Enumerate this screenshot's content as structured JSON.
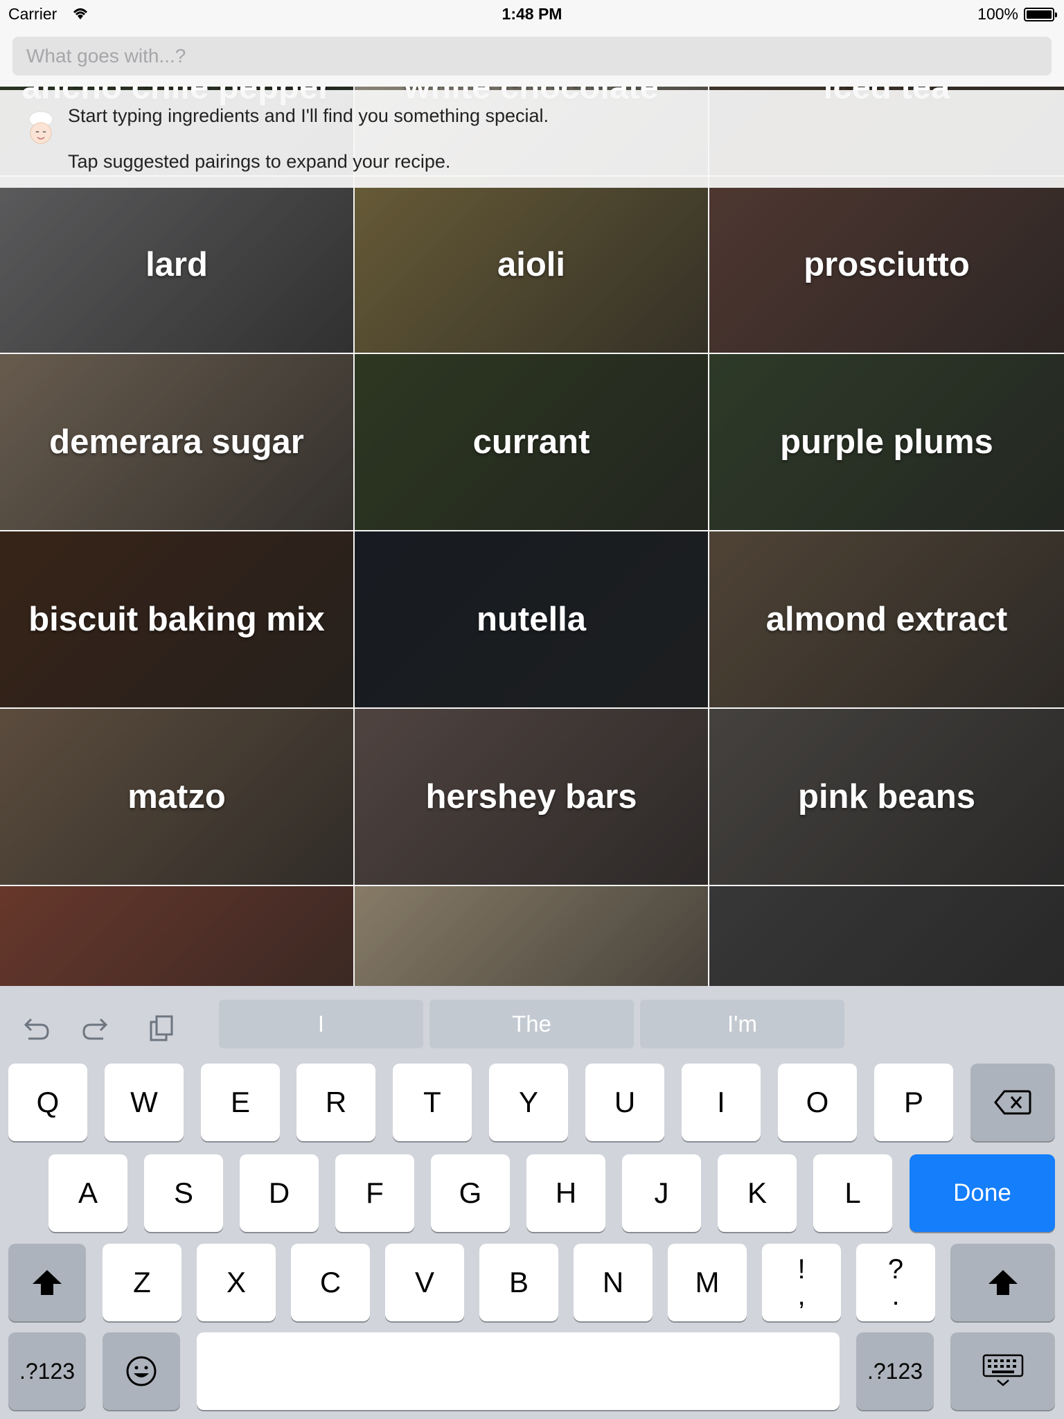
{
  "status": {
    "carrier": "Carrier",
    "time": "1:48 PM",
    "battery": "100%"
  },
  "search": {
    "placeholder": "What goes with...?"
  },
  "info": {
    "line1": "Start typing ingredients and I'll find you something special.",
    "line2": "Tap suggested pairings to expand your recipe."
  },
  "tiles": [
    {
      "label": "ancho chile pepper",
      "color": "#3a4a30"
    },
    {
      "label": "white chocolate",
      "color": "#c9c0ad"
    },
    {
      "label": "iced tea",
      "color": "#5a4a3a"
    },
    {
      "label": "lard",
      "color": "#7a7a7c"
    },
    {
      "label": "aioli",
      "color": "#8a7a4a"
    },
    {
      "label": "prosciutto",
      "color": "#6a4a42"
    },
    {
      "label": "demerara sugar",
      "color": "#8a7a68"
    },
    {
      "label": "currant",
      "color": "#3c4a2c"
    },
    {
      "label": "purple plums",
      "color": "#3e4e36"
    },
    {
      "label": "biscuit baking mix",
      "color": "#4a3020"
    },
    {
      "label": "nutella",
      "color": "#1f252c"
    },
    {
      "label": "almond extract",
      "color": "#6a5a48"
    },
    {
      "label": "matzo",
      "color": "#7a6652"
    },
    {
      "label": "hershey bars",
      "color": "#6a5a55"
    },
    {
      "label": "pink beans",
      "color": "#5c5854"
    },
    {
      "label": "",
      "color": "#8a4a3a"
    },
    {
      "label": "",
      "color": "#b5a58a"
    },
    {
      "label": "",
      "color": "#4a4a4a"
    }
  ],
  "keyboard": {
    "suggestions": [
      "I",
      "The",
      "I'm"
    ],
    "row1": [
      "Q",
      "W",
      "E",
      "R",
      "T",
      "Y",
      "U",
      "I",
      "O",
      "P"
    ],
    "row2": [
      "A",
      "S",
      "D",
      "F",
      "G",
      "H",
      "J",
      "K",
      "L"
    ],
    "done": "Done",
    "row3": [
      "Z",
      "X",
      "C",
      "V",
      "B",
      "N",
      "M"
    ],
    "punct1": [
      "!",
      ","
    ],
    "punct2": [
      "?",
      "."
    ],
    "numbers_label": ".?123",
    "icons": {
      "undo": "undo-icon",
      "redo": "redo-icon",
      "paste": "paste-icon",
      "backspace": "backspace-icon",
      "shift": "shift-icon",
      "emoji": "emoji-icon",
      "dismiss": "keyboard-dismiss-icon"
    }
  }
}
